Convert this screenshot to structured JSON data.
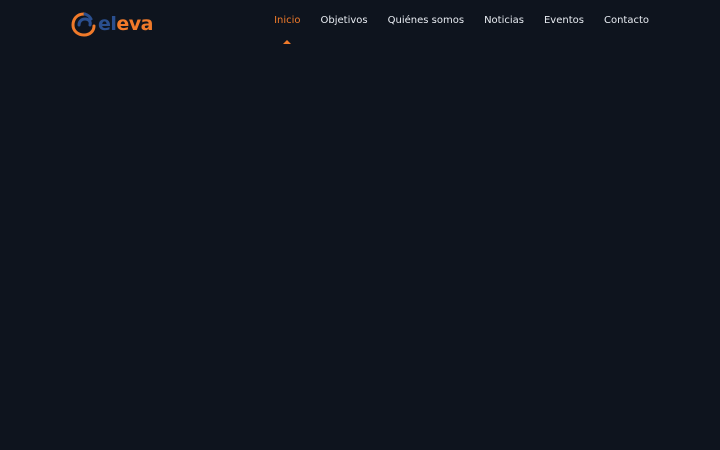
{
  "brand": {
    "logo_text_part1": "el",
    "logo_text_part2": "eva",
    "primary_color": "#2a4f8f",
    "accent_color": "#f07a2a",
    "logo_icon": "eleva-swirl-logo-icon"
  },
  "nav": {
    "items": [
      {
        "label": "Inicio",
        "active": true
      },
      {
        "label": "Objetivos",
        "active": false
      },
      {
        "label": "Quiénes somos",
        "active": false
      },
      {
        "label": "Noticias",
        "active": false
      },
      {
        "label": "Eventos",
        "active": false
      },
      {
        "label": "Contacto",
        "active": false
      }
    ]
  },
  "theme": {
    "background": "#0e141e",
    "nav_text": "#e8ecf2"
  }
}
